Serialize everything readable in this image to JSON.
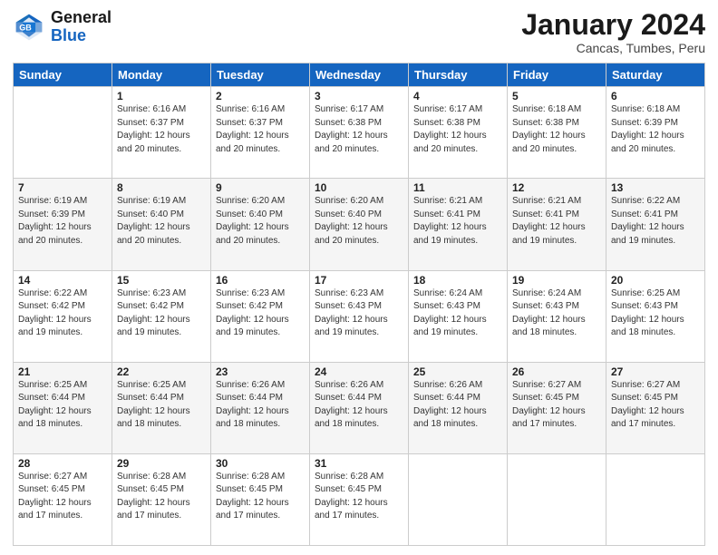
{
  "header": {
    "logo_line1": "General",
    "logo_line2": "Blue",
    "month_title": "January 2024",
    "location": "Cancas, Tumbes, Peru"
  },
  "days_of_week": [
    "Sunday",
    "Monday",
    "Tuesday",
    "Wednesday",
    "Thursday",
    "Friday",
    "Saturday"
  ],
  "weeks": [
    [
      {
        "day": "",
        "sunrise": "",
        "sunset": "",
        "daylight": ""
      },
      {
        "day": "1",
        "sunrise": "Sunrise: 6:16 AM",
        "sunset": "Sunset: 6:37 PM",
        "daylight": "Daylight: 12 hours and 20 minutes."
      },
      {
        "day": "2",
        "sunrise": "Sunrise: 6:16 AM",
        "sunset": "Sunset: 6:37 PM",
        "daylight": "Daylight: 12 hours and 20 minutes."
      },
      {
        "day": "3",
        "sunrise": "Sunrise: 6:17 AM",
        "sunset": "Sunset: 6:38 PM",
        "daylight": "Daylight: 12 hours and 20 minutes."
      },
      {
        "day": "4",
        "sunrise": "Sunrise: 6:17 AM",
        "sunset": "Sunset: 6:38 PM",
        "daylight": "Daylight: 12 hours and 20 minutes."
      },
      {
        "day": "5",
        "sunrise": "Sunrise: 6:18 AM",
        "sunset": "Sunset: 6:38 PM",
        "daylight": "Daylight: 12 hours and 20 minutes."
      },
      {
        "day": "6",
        "sunrise": "Sunrise: 6:18 AM",
        "sunset": "Sunset: 6:39 PM",
        "daylight": "Daylight: 12 hours and 20 minutes."
      }
    ],
    [
      {
        "day": "7",
        "sunrise": "Sunrise: 6:19 AM",
        "sunset": "Sunset: 6:39 PM",
        "daylight": "Daylight: 12 hours and 20 minutes."
      },
      {
        "day": "8",
        "sunrise": "Sunrise: 6:19 AM",
        "sunset": "Sunset: 6:40 PM",
        "daylight": "Daylight: 12 hours and 20 minutes."
      },
      {
        "day": "9",
        "sunrise": "Sunrise: 6:20 AM",
        "sunset": "Sunset: 6:40 PM",
        "daylight": "Daylight: 12 hours and 20 minutes."
      },
      {
        "day": "10",
        "sunrise": "Sunrise: 6:20 AM",
        "sunset": "Sunset: 6:40 PM",
        "daylight": "Daylight: 12 hours and 20 minutes."
      },
      {
        "day": "11",
        "sunrise": "Sunrise: 6:21 AM",
        "sunset": "Sunset: 6:41 PM",
        "daylight": "Daylight: 12 hours and 19 minutes."
      },
      {
        "day": "12",
        "sunrise": "Sunrise: 6:21 AM",
        "sunset": "Sunset: 6:41 PM",
        "daylight": "Daylight: 12 hours and 19 minutes."
      },
      {
        "day": "13",
        "sunrise": "Sunrise: 6:22 AM",
        "sunset": "Sunset: 6:41 PM",
        "daylight": "Daylight: 12 hours and 19 minutes."
      }
    ],
    [
      {
        "day": "14",
        "sunrise": "Sunrise: 6:22 AM",
        "sunset": "Sunset: 6:42 PM",
        "daylight": "Daylight: 12 hours and 19 minutes."
      },
      {
        "day": "15",
        "sunrise": "Sunrise: 6:23 AM",
        "sunset": "Sunset: 6:42 PM",
        "daylight": "Daylight: 12 hours and 19 minutes."
      },
      {
        "day": "16",
        "sunrise": "Sunrise: 6:23 AM",
        "sunset": "Sunset: 6:42 PM",
        "daylight": "Daylight: 12 hours and 19 minutes."
      },
      {
        "day": "17",
        "sunrise": "Sunrise: 6:23 AM",
        "sunset": "Sunset: 6:43 PM",
        "daylight": "Daylight: 12 hours and 19 minutes."
      },
      {
        "day": "18",
        "sunrise": "Sunrise: 6:24 AM",
        "sunset": "Sunset: 6:43 PM",
        "daylight": "Daylight: 12 hours and 19 minutes."
      },
      {
        "day": "19",
        "sunrise": "Sunrise: 6:24 AM",
        "sunset": "Sunset: 6:43 PM",
        "daylight": "Daylight: 12 hours and 18 minutes."
      },
      {
        "day": "20",
        "sunrise": "Sunrise: 6:25 AM",
        "sunset": "Sunset: 6:43 PM",
        "daylight": "Daylight: 12 hours and 18 minutes."
      }
    ],
    [
      {
        "day": "21",
        "sunrise": "Sunrise: 6:25 AM",
        "sunset": "Sunset: 6:44 PM",
        "daylight": "Daylight: 12 hours and 18 minutes."
      },
      {
        "day": "22",
        "sunrise": "Sunrise: 6:25 AM",
        "sunset": "Sunset: 6:44 PM",
        "daylight": "Daylight: 12 hours and 18 minutes."
      },
      {
        "day": "23",
        "sunrise": "Sunrise: 6:26 AM",
        "sunset": "Sunset: 6:44 PM",
        "daylight": "Daylight: 12 hours and 18 minutes."
      },
      {
        "day": "24",
        "sunrise": "Sunrise: 6:26 AM",
        "sunset": "Sunset: 6:44 PM",
        "daylight": "Daylight: 12 hours and 18 minutes."
      },
      {
        "day": "25",
        "sunrise": "Sunrise: 6:26 AM",
        "sunset": "Sunset: 6:44 PM",
        "daylight": "Daylight: 12 hours and 18 minutes."
      },
      {
        "day": "26",
        "sunrise": "Sunrise: 6:27 AM",
        "sunset": "Sunset: 6:45 PM",
        "daylight": "Daylight: 12 hours and 17 minutes."
      },
      {
        "day": "27",
        "sunrise": "Sunrise: 6:27 AM",
        "sunset": "Sunset: 6:45 PM",
        "daylight": "Daylight: 12 hours and 17 minutes."
      }
    ],
    [
      {
        "day": "28",
        "sunrise": "Sunrise: 6:27 AM",
        "sunset": "Sunset: 6:45 PM",
        "daylight": "Daylight: 12 hours and 17 minutes."
      },
      {
        "day": "29",
        "sunrise": "Sunrise: 6:28 AM",
        "sunset": "Sunset: 6:45 PM",
        "daylight": "Daylight: 12 hours and 17 minutes."
      },
      {
        "day": "30",
        "sunrise": "Sunrise: 6:28 AM",
        "sunset": "Sunset: 6:45 PM",
        "daylight": "Daylight: 12 hours and 17 minutes."
      },
      {
        "day": "31",
        "sunrise": "Sunrise: 6:28 AM",
        "sunset": "Sunset: 6:45 PM",
        "daylight": "Daylight: 12 hours and 17 minutes."
      },
      {
        "day": "",
        "sunrise": "",
        "sunset": "",
        "daylight": ""
      },
      {
        "day": "",
        "sunrise": "",
        "sunset": "",
        "daylight": ""
      },
      {
        "day": "",
        "sunrise": "",
        "sunset": "",
        "daylight": ""
      }
    ]
  ]
}
